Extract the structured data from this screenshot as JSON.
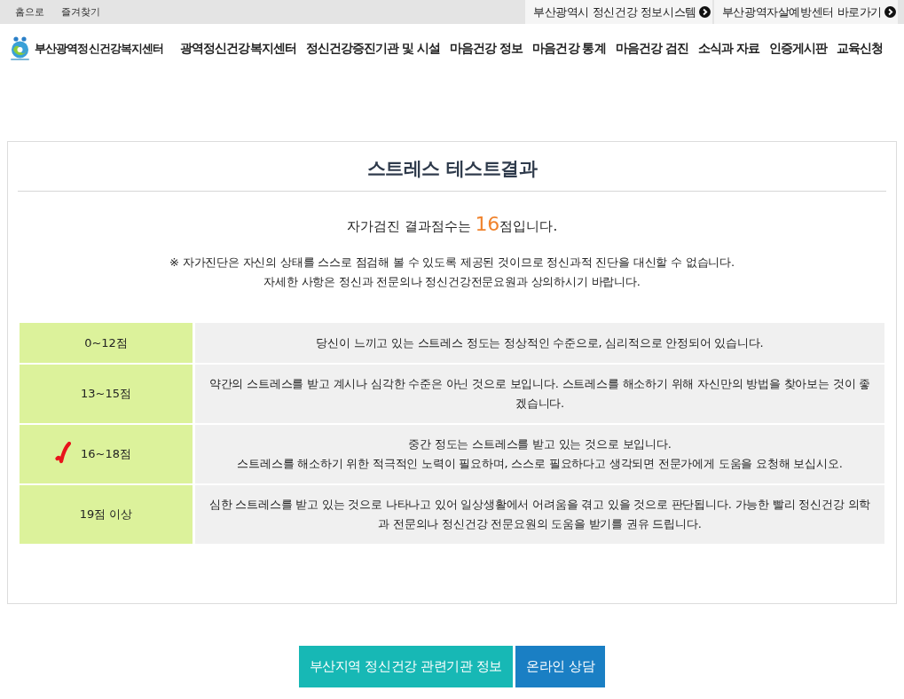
{
  "top_bar": {
    "links": [
      "홈으로",
      "즐겨찾기"
    ],
    "external_links": [
      "부산광역시 정신건강 정보시스템",
      "부산광역자살예방센터 바로가기"
    ]
  },
  "header": {
    "site_name": "부산광역정신건강복지센터",
    "nav": [
      "광역정신건강복지센터",
      "정신건강증진기관 및 시설",
      "마음건강 정보",
      "마음건강 통계",
      "마음건강 검진",
      "소식과 자료",
      "인증게시판",
      "교육신청"
    ]
  },
  "result": {
    "title": "스트레스 테스트결과",
    "score_prefix": "자가검진 결과점수는 ",
    "score": "16",
    "score_suffix": "점입니다.",
    "notes": [
      "※ 자가진단은 자신의 상태를 스스로 점검해 볼 수 있도록 제공된 것이므로 정신과적 진단을 대신할 수 없습니다.",
      "자세한 사항은 정신과 전문의나 정신건강전문요원과 상의하시기 바랍니다."
    ]
  },
  "table": {
    "rows": [
      {
        "range": "0~12점",
        "description": [
          "당신이 느끼고 있는 스트레스 정도는 정상적인 수준으로, 심리적으로 안정되어 있습니다."
        ],
        "selected": false
      },
      {
        "range": "13~15점",
        "description": [
          "약간의 스트레스를 받고 계시나 심각한 수준은 아닌 것으로 보입니다. 스트레스를 해소하기 위해 자신만의 방법을 찾아보는 것이 좋겠습니다."
        ],
        "selected": false
      },
      {
        "range": "16~18점",
        "description": [
          "중간 정도는 스트레스를 받고 있는 것으로 보입니다.",
          "스트레스를 해소하기 위한 적극적인 노력이 필요하며, 스스로 필요하다고 생각되면 전문가에게 도움을 요청해 보십시오."
        ],
        "selected": true
      },
      {
        "range": "19점 이상",
        "description": [
          "심한 스트레스를 받고 있는 것으로 나타나고 있어 일상생활에서 어려움을 겪고 있을 것으로 판단됩니다. 가능한 빨리 정신건강 의학과 전문의나 정신건강 전문요원의 도움을 받기를 권유 드립니다."
        ],
        "selected": false
      }
    ]
  },
  "buttons": [
    {
      "label": "부산지역 정신건강 관련기관 정보",
      "kind": "teal"
    },
    {
      "label": "온라인 상담",
      "kind": "blue"
    }
  ]
}
